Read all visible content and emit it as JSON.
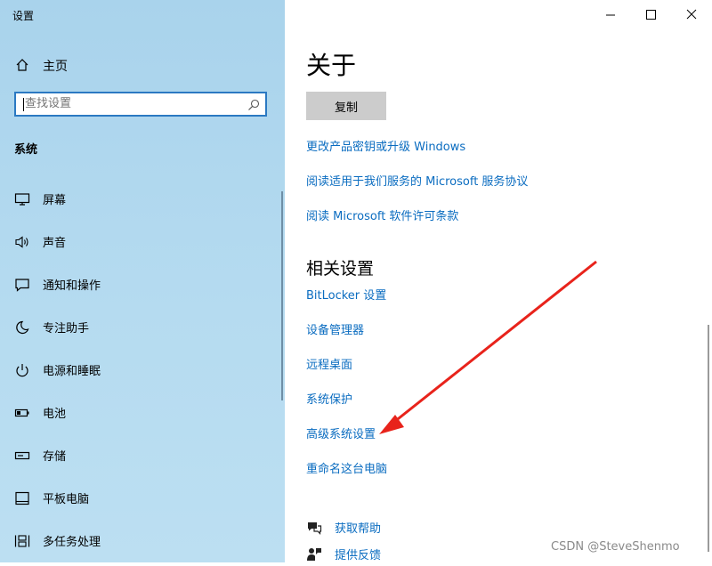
{
  "window": {
    "title": "设置"
  },
  "sidebar": {
    "home_label": "主页",
    "search_placeholder": "查找设置",
    "section_title": "系统",
    "items": [
      {
        "label": "屏幕",
        "icon": "monitor-icon"
      },
      {
        "label": "声音",
        "icon": "speaker-icon"
      },
      {
        "label": "通知和操作",
        "icon": "notification-icon"
      },
      {
        "label": "专注助手",
        "icon": "moon-icon"
      },
      {
        "label": "电源和睡眠",
        "icon": "power-icon"
      },
      {
        "label": "电池",
        "icon": "battery-icon"
      },
      {
        "label": "存储",
        "icon": "storage-icon"
      },
      {
        "label": "平板电脑",
        "icon": "tablet-icon"
      },
      {
        "label": "多任务处理",
        "icon": "multitasking-icon"
      }
    ]
  },
  "main": {
    "title": "关于",
    "copy_button": "复制",
    "links": [
      "更改产品密钥或升级 Windows",
      "阅读适用于我们服务的 Microsoft 服务协议",
      "阅读 Microsoft 软件许可条款"
    ],
    "related_title": "相关设置",
    "related_links": [
      "BitLocker 设置",
      "设备管理器",
      "远程桌面",
      "系统保护",
      "高级系统设置",
      "重命名这台电脑"
    ],
    "help": [
      {
        "label": "获取帮助",
        "icon": "help-chat-icon"
      },
      {
        "label": "提供反馈",
        "icon": "feedback-icon"
      }
    ]
  },
  "watermark": "CSDN @SteveShenmo",
  "colors": {
    "accent": "#0a6cc0",
    "arrow": "#e8231b",
    "sidebar": "#b5dbf0"
  }
}
